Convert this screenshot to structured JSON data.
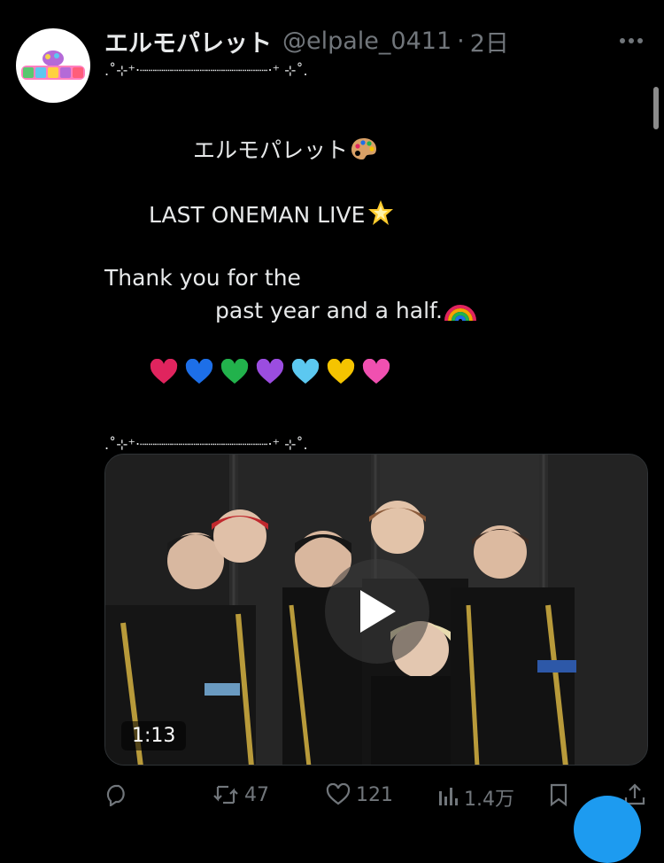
{
  "tweet": {
    "display_name": "エルモパレット",
    "handle": "@elpale_0411",
    "separator": "·",
    "time": "2日",
    "lines": [
      ".˚⊹⁺‧┈┈┈┈┈┈┈┈┈┈┈┈┈┈┈‧⁺ ⊹˚.",
      "",
      "　　　　エルモパレット",
      "",
      "　　LAST ONEMAN LIVE",
      "",
      "Thank you for the",
      "　　　　　past year and a half.",
      "",
      "　　",
      "",
      ".˚⊹⁺‧┈┈┈┈┈┈┈┈┈┈┈┈┈┈┈‧⁺ ⊹˚."
    ],
    "emojis": {
      "palette": "artist-palette-emoji",
      "star": "glowing-star-emoji",
      "rainbow": "rainbow-emoji",
      "hearts": [
        "#e0245e",
        "#1d6fe8",
        "#22b24c",
        "#9b4de0",
        "#5cc8f0",
        "#f5c400",
        "#f050b0"
      ]
    }
  },
  "media": {
    "duration": "1:13",
    "play_icon": "play-icon"
  },
  "actions": {
    "reply": {
      "icon": "reply-icon",
      "count": ""
    },
    "retweet": {
      "icon": "retweet-icon",
      "count": "47"
    },
    "like": {
      "icon": "heart-icon",
      "count": "121"
    },
    "views": {
      "icon": "views-icon",
      "count": "1.4万"
    },
    "bookmark": {
      "icon": "bookmark-icon",
      "count": ""
    },
    "share": {
      "icon": "share-icon",
      "count": ""
    }
  },
  "colors": {
    "background": "#000000",
    "text": "#e7e9ea",
    "secondary": "#71767b",
    "accent": "#1d9bf0"
  }
}
